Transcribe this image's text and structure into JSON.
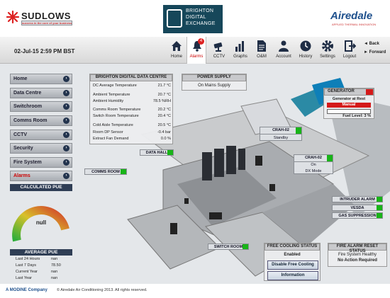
{
  "header": {
    "left_logo": "SUDLOWS",
    "left_logo_tag": "success in the core of your business",
    "center_logo_lines": [
      "BRIGHTON",
      "DIGITAL",
      "EXCHANGE"
    ],
    "right_logo": "Airedale",
    "right_logo_tag": "APPLIED THERMAL INNOVATION"
  },
  "datetime": "02-Jul-15 2:59 PM BST",
  "nav": [
    {
      "label": "Home",
      "icon": "home-icon"
    },
    {
      "label": "Alarms",
      "icon": "alarm-bell-icon",
      "badge": "4",
      "active": true
    },
    {
      "label": "CCTV",
      "icon": "cctv-camera-icon"
    },
    {
      "label": "Graphs",
      "icon": "bar-chart-icon"
    },
    {
      "label": "O&M",
      "icon": "document-icon"
    },
    {
      "label": "Account",
      "icon": "account-user-icon"
    },
    {
      "label": "History",
      "icon": "clock-icon"
    },
    {
      "label": "Settings",
      "icon": "gear-icon"
    },
    {
      "label": "Logout",
      "icon": "logout-icon"
    }
  ],
  "back_label": "Back",
  "forward_label": "Forward",
  "menu": [
    "Home",
    "Data Centre",
    "Switchroom",
    "Comms Room",
    "CCTV",
    "Security",
    "Fire System",
    "Alarms"
  ],
  "calculated_pue": {
    "title": "CALCULATED PUE",
    "value": "null"
  },
  "average_pue": {
    "title": "AVERAGE PUE",
    "rows": [
      {
        "k": "Last 24 Hours",
        "v": "nan"
      },
      {
        "k": "Last 7 Days",
        "v": "78.50"
      },
      {
        "k": "Current Year",
        "v": "nan"
      },
      {
        "k": "Last Year",
        "v": "nan"
      }
    ]
  },
  "datacentre": {
    "title": "BRIGHTON DIGITAL DATA CENTRE",
    "rows": [
      {
        "k": "DC Average Temperature",
        "v": "21.7 °C"
      },
      {
        "k": "Ambient Temperature",
        "v": "20.7 °C"
      },
      {
        "k": "Ambient Humidity",
        "v": "78.5 %RH"
      },
      {
        "k": "Comms Room Temperature",
        "v": "20.2 °C"
      },
      {
        "k": "Switch Room Temperature",
        "v": "20.4 °C"
      },
      {
        "k": "Cold Aisle Temperature",
        "v": "20.5 °C"
      },
      {
        "k": "Room DP Sensor",
        "v": "-0.4 bar"
      },
      {
        "k": "Extract Fan Demand",
        "v": "0.0 %"
      }
    ]
  },
  "power_supply": {
    "title": "POWER SUPPLY",
    "value": "On Mains Supply"
  },
  "generator": {
    "title": "GENERATOR",
    "status": "Generator at Rest",
    "mode": "Manual",
    "fuel": "Fuel Level: 3 %"
  },
  "crah01": {
    "title": "CRAH-02",
    "status": "Standby"
  },
  "crah02": {
    "title": "CRAH-02",
    "status": "On",
    "mode": "DX Mode"
  },
  "labels": {
    "data_hall": "DATA HALL",
    "comms_room": "COMMS ROOM",
    "switch_room": "SWITCH ROOM"
  },
  "alarms": [
    "INTRUDER ALARM",
    "VESDA",
    "GAS SUPPRESSION"
  ],
  "free_cooling": {
    "title": "FREE COOLING STATUS",
    "status": "Enabled",
    "disable_btn": "Disable Free Cooling",
    "info_btn": "Information"
  },
  "fire_alarm": {
    "title": "FIRE ALARM RESET STATUS",
    "status": "Fire System Healthy",
    "action": "No Action Required"
  },
  "footer": {
    "brand": "A MODINE Company",
    "copyright": "© Airedale Air Conditioning 2013. All rights reserved."
  },
  "colors": {
    "ok": "#18b418",
    "alarm": "#d41a1a",
    "navy": "#2f3e55"
  }
}
